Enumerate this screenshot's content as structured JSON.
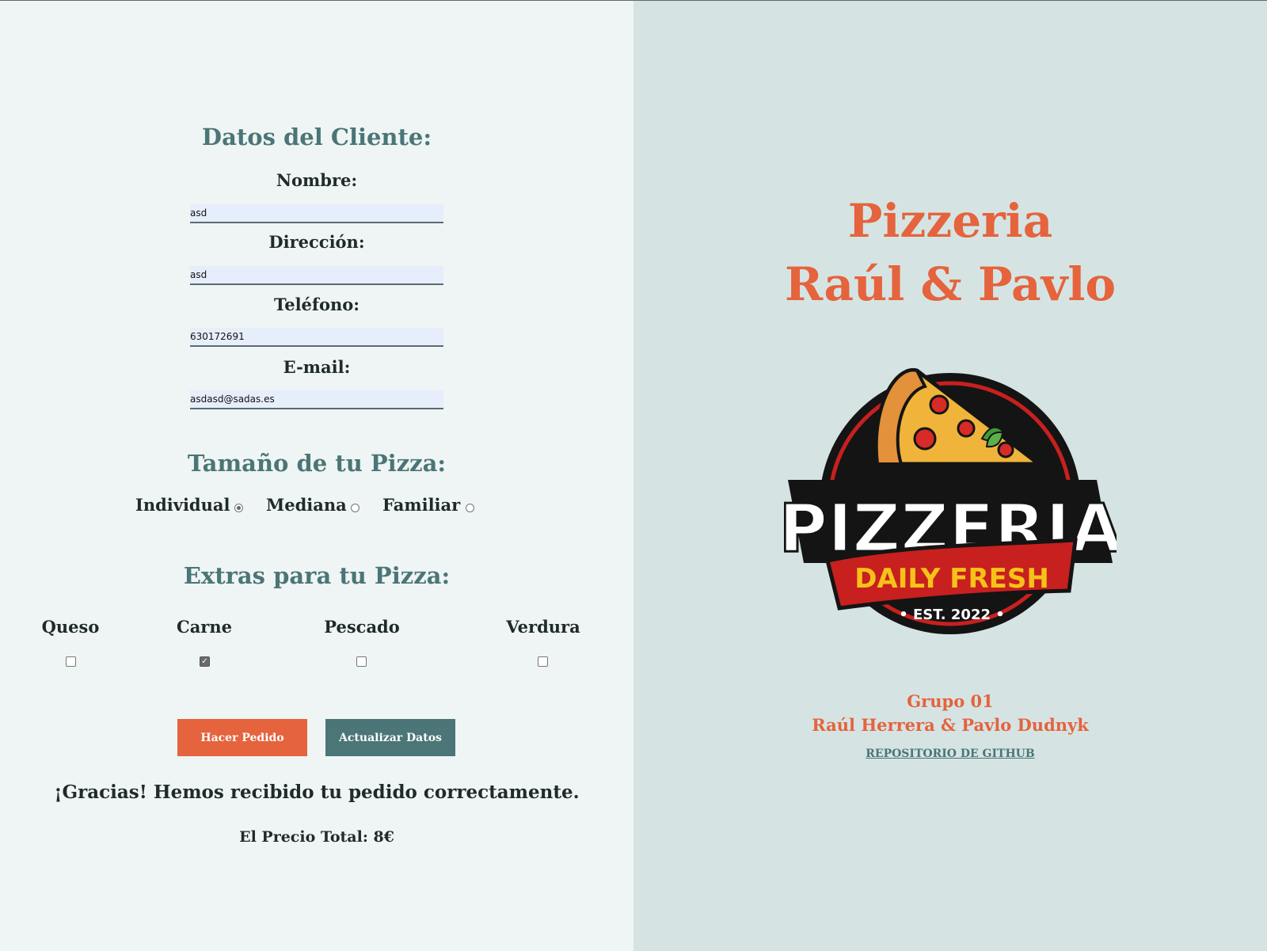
{
  "form": {
    "client_heading": "Datos del Cliente:",
    "name_label": "Nombre:",
    "name_value": "asd",
    "address_label": "Dirección:",
    "address_value": "asd",
    "phone_label": "Teléfono:",
    "phone_value": "630172691",
    "email_label": "E-mail:",
    "email_value": "asdasd@sadas.es",
    "size_heading": "Tamaño de tu Pizza:",
    "sizes": [
      {
        "label": "Individual",
        "selected": true
      },
      {
        "label": "Mediana",
        "selected": false
      },
      {
        "label": "Familiar",
        "selected": false
      }
    ],
    "extras_heading": "Extras para tu Pizza:",
    "extras": [
      {
        "label": "Queso",
        "checked": false
      },
      {
        "label": "Carne",
        "checked": true
      },
      {
        "label": "Pescado",
        "checked": false
      },
      {
        "label": "Verdura",
        "checked": false
      }
    ],
    "order_button": "Hacer Pedido",
    "update_button": "Actualizar Datos",
    "confirmation": "¡Gracias! Hemos recibido tu pedido correctamente.",
    "total_price": "El Precio Total: 8€"
  },
  "brand": {
    "title_line1": "Pizzeria",
    "title_line2": "Raúl & Pavlo",
    "logo_word": "PIZZERIA",
    "logo_ribbon": "DAILY FRESH",
    "logo_est": "• EST. 2022 •",
    "group": "Grupo 01",
    "authors": "Raúl Herrera & Pavlo Dudnyk",
    "repo_link": "REPOSITORIO DE GITHUB"
  },
  "colors": {
    "accent": "#e5633d",
    "teal": "#4b7576",
    "left_bg": "#eef5f4",
    "right_bg": "#d5e4e3"
  }
}
